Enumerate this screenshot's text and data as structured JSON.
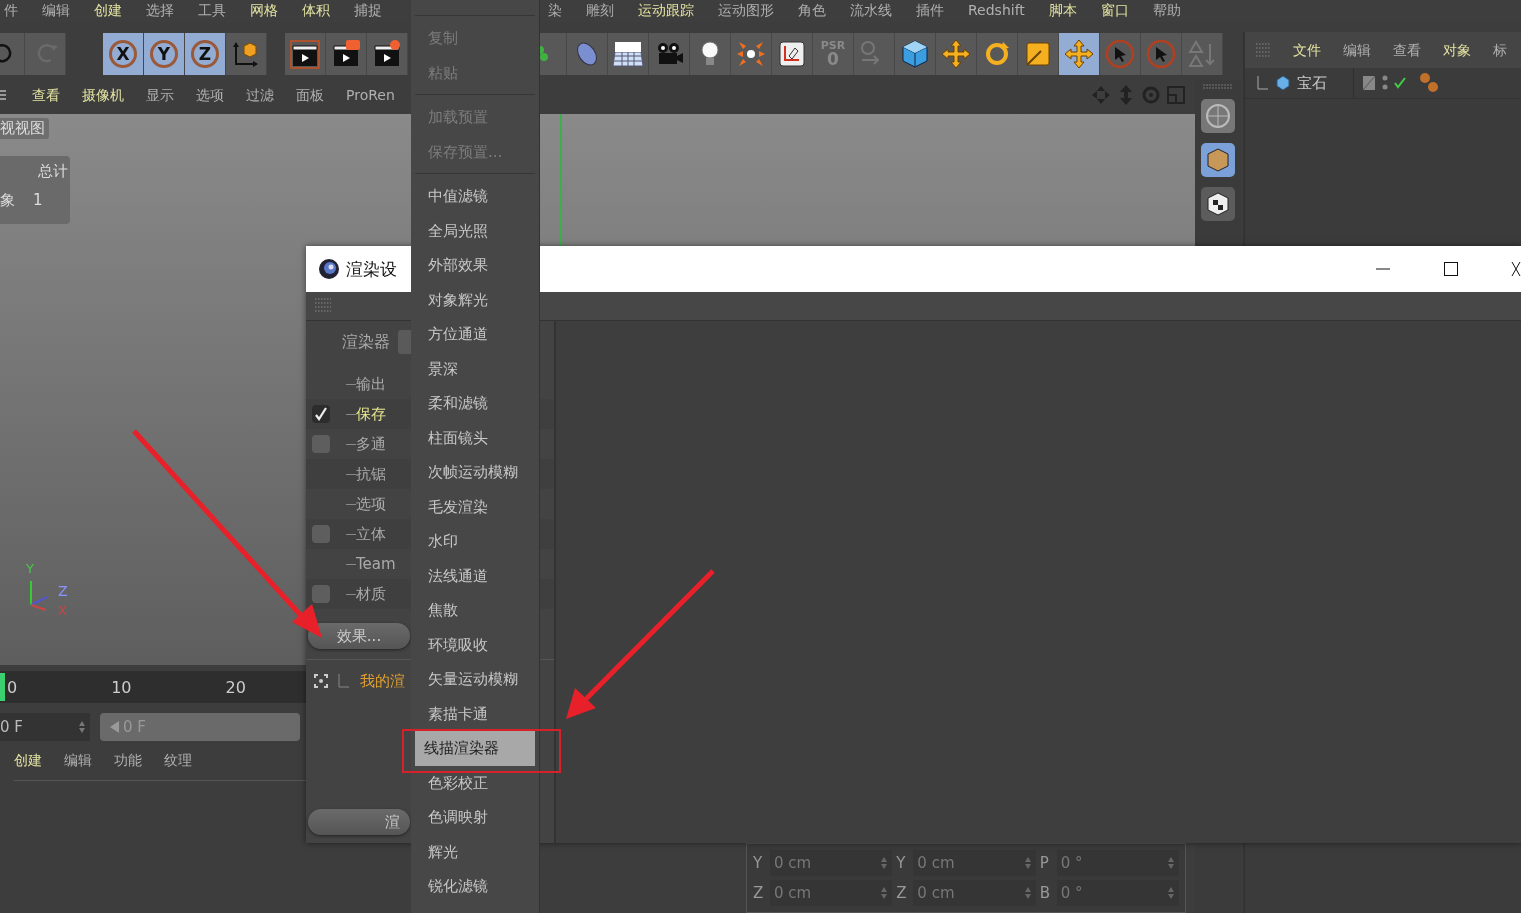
{
  "menubar": [
    [
      {
        "label": "件",
        "accent": false
      },
      {
        "label": "编辑",
        "accent": false
      },
      {
        "label": "创建",
        "accent": true
      },
      {
        "label": "选择",
        "accent": false
      },
      {
        "label": "工具",
        "accent": false
      },
      {
        "label": "网格",
        "accent": true
      },
      {
        "label": "体积",
        "accent": true
      },
      {
        "label": "捕捉",
        "accent": false
      }
    ],
    [
      {
        "label": "染",
        "accent": false
      },
      {
        "label": "雕刻",
        "accent": false
      },
      {
        "label": "运动跟踪",
        "accent": true
      },
      {
        "label": "运动图形",
        "accent": false
      },
      {
        "label": "角色",
        "accent": false
      },
      {
        "label": "流水线",
        "accent": false
      },
      {
        "label": "插件",
        "accent": false
      },
      {
        "label": "Redshift",
        "accent": false
      },
      {
        "label": "脚本",
        "accent": true
      },
      {
        "label": "窗口",
        "accent": true
      },
      {
        "label": "帮助",
        "accent": false
      }
    ]
  ],
  "toolbar": [
    [
      {
        "kind": "undo",
        "selected": false
      },
      {
        "kind": "redo",
        "selected": false
      }
    ],
    [
      {
        "kind": "axis",
        "label": "X",
        "selected": true
      },
      {
        "kind": "axis",
        "label": "Y",
        "selected": true
      },
      {
        "kind": "axis",
        "label": "Z",
        "selected": true
      },
      {
        "kind": "coord",
        "selected": false
      }
    ],
    [
      {
        "kind": "render-view",
        "selected": false
      },
      {
        "kind": "render-picture",
        "selected": false
      },
      {
        "kind": "render-settings",
        "selected": false
      }
    ],
    [
      {
        "kind": "generator",
        "selected": false
      },
      {
        "kind": "spline",
        "selected": false
      },
      {
        "kind": "plane",
        "selected": false
      },
      {
        "kind": "camera",
        "selected": false
      },
      {
        "kind": "light",
        "selected": false
      },
      {
        "kind": "mograph",
        "selected": false
      },
      {
        "kind": "deformer",
        "selected": false
      },
      {
        "kind": "psr",
        "label": "PSR",
        "value": "0",
        "selected": false
      },
      {
        "kind": "lock",
        "selected": false
      },
      {
        "kind": "cube",
        "selected": false
      },
      {
        "kind": "move",
        "selected": false
      },
      {
        "kind": "rotate",
        "selected": false
      },
      {
        "kind": "scale",
        "selected": false
      },
      {
        "kind": "move",
        "selected": true
      },
      {
        "kind": "select",
        "selected": false
      },
      {
        "kind": "select",
        "selected": false
      },
      {
        "kind": "symmetry",
        "selected": false
      }
    ]
  ],
  "viewport": {
    "menu": [
      {
        "label": "查看",
        "accent": true
      },
      {
        "label": "摄像机",
        "accent": true
      },
      {
        "label": "显示",
        "accent": false
      },
      {
        "label": "选项",
        "accent": false
      },
      {
        "label": "过滤",
        "accent": false
      },
      {
        "label": "面板",
        "accent": false
      },
      {
        "label": "ProRen",
        "accent": false
      }
    ],
    "title": "视视图",
    "stats_header": "总计",
    "stats_rows": [
      {
        "label": "象",
        "value": "1"
      }
    ],
    "axis_labels": [
      "Y",
      "Z",
      "X"
    ]
  },
  "timeline": {
    "ticks": [
      "0",
      "10",
      "20"
    ],
    "frame_field": "0 F",
    "slider_value": "0 F",
    "level": 0
  },
  "material_menu": [
    {
      "label": "创建",
      "accent": true
    },
    {
      "label": "编辑",
      "accent": false
    },
    {
      "label": "功能",
      "accent": false
    },
    {
      "label": "纹理",
      "accent": false
    }
  ],
  "coordinates": [
    [
      {
        "axis": "Y",
        "value": "0 cm"
      },
      {
        "axis": "Y",
        "value": "0 cm"
      },
      {
        "axis": "P",
        "value": "0 °"
      }
    ],
    [
      {
        "axis": "Z",
        "value": "0 cm"
      },
      {
        "axis": "Z",
        "value": "0 cm"
      },
      {
        "axis": "B",
        "value": "0 °"
      }
    ]
  ],
  "object_manager": {
    "menu": [
      {
        "label": "文件",
        "accent": true
      },
      {
        "label": "编辑",
        "accent": false
      },
      {
        "label": "查看",
        "accent": false
      },
      {
        "label": "对象",
        "accent": true
      },
      {
        "label": "标",
        "accent": false
      }
    ],
    "objects": [
      {
        "name": "宝石"
      }
    ]
  },
  "render_settings": {
    "title": "渲染设",
    "renderer_label": "渲染器",
    "items": [
      {
        "kind": "plain",
        "label": "输出",
        "selected": false
      },
      {
        "kind": "checkbox",
        "label": "保存",
        "checked": true,
        "selected": true
      },
      {
        "kind": "checkbox",
        "label": "多通",
        "checked": false,
        "selected": false
      },
      {
        "kind": "plain",
        "label": "抗锯",
        "selected": false
      },
      {
        "kind": "plain",
        "label": "选项",
        "selected": false
      },
      {
        "kind": "checkbox",
        "label": "立体",
        "checked": false,
        "selected": false
      },
      {
        "kind": "plain",
        "label": "Team",
        "selected": false
      },
      {
        "kind": "checkbox",
        "label": "材质",
        "checked": false,
        "selected": false
      }
    ],
    "effects_button": "效果...",
    "preset": "我的渲",
    "render_button": "渲"
  },
  "context_menu": [
    {
      "kind": "separator"
    },
    {
      "kind": "item",
      "label": "复制",
      "disabled": true,
      "selected": false
    },
    {
      "kind": "item",
      "label": "粘贴",
      "disabled": true,
      "selected": false
    },
    {
      "kind": "separator"
    },
    {
      "kind": "item",
      "label": "加载预置",
      "disabled": true,
      "selected": false
    },
    {
      "kind": "item",
      "label": "保存预置...",
      "disabled": true,
      "selected": false
    },
    {
      "kind": "separator"
    },
    {
      "kind": "item",
      "label": "中值滤镜",
      "disabled": false,
      "selected": false
    },
    {
      "kind": "item",
      "label": "全局光照",
      "disabled": false,
      "selected": false
    },
    {
      "kind": "item",
      "label": "外部效果",
      "disabled": false,
      "selected": false
    },
    {
      "kind": "item",
      "label": "对象辉光",
      "disabled": false,
      "selected": false
    },
    {
      "kind": "item",
      "label": "方位通道",
      "disabled": false,
      "selected": false
    },
    {
      "kind": "item",
      "label": "景深",
      "disabled": false,
      "selected": false
    },
    {
      "kind": "item",
      "label": "柔和滤镜",
      "disabled": false,
      "selected": false
    },
    {
      "kind": "item",
      "label": "柱面镜头",
      "disabled": false,
      "selected": false
    },
    {
      "kind": "item",
      "label": "次帧运动模糊",
      "disabled": false,
      "selected": false
    },
    {
      "kind": "item",
      "label": "毛发渲染",
      "disabled": false,
      "selected": false
    },
    {
      "kind": "item",
      "label": "水印",
      "disabled": false,
      "selected": false
    },
    {
      "kind": "item",
      "label": "法线通道",
      "disabled": false,
      "selected": false
    },
    {
      "kind": "item",
      "label": "焦散",
      "disabled": false,
      "selected": false
    },
    {
      "kind": "item",
      "label": "环境吸收",
      "disabled": false,
      "selected": false
    },
    {
      "kind": "item",
      "label": "矢量运动模糊",
      "disabled": false,
      "selected": false
    },
    {
      "kind": "item",
      "label": "素描卡通",
      "disabled": false,
      "selected": false
    },
    {
      "kind": "item",
      "label": "线描渲染器",
      "disabled": false,
      "selected": true
    },
    {
      "kind": "item",
      "label": "色彩校正",
      "disabled": false,
      "selected": false
    },
    {
      "kind": "item",
      "label": "色调映射",
      "disabled": false,
      "selected": false
    },
    {
      "kind": "item",
      "label": "辉光",
      "disabled": false,
      "selected": false
    },
    {
      "kind": "item",
      "label": "锐化滤镜",
      "disabled": false,
      "selected": false
    }
  ]
}
